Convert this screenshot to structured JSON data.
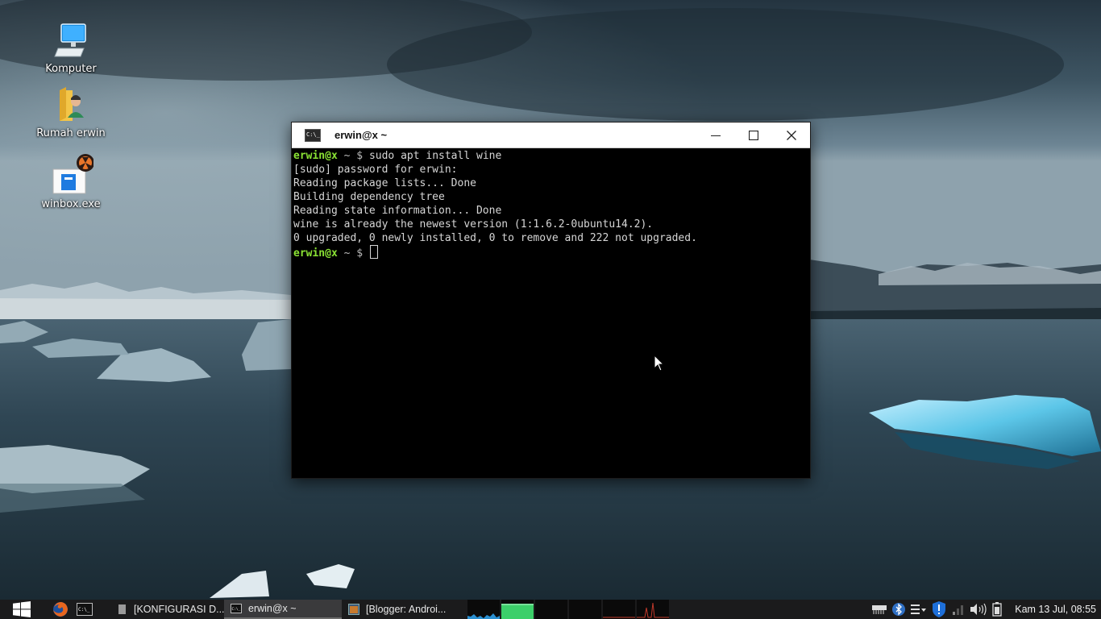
{
  "desktop": {
    "icons": [
      {
        "label": "Komputer",
        "icon": "computer-icon"
      },
      {
        "label": "Rumah erwin",
        "icon": "home-folder-icon"
      },
      {
        "label": "winbox.exe",
        "icon": "wine-exe-icon"
      }
    ]
  },
  "terminal": {
    "title": "erwin@x ~",
    "prompt_user": "erwin@x",
    "prompt_path": "~ $",
    "command": "sudo apt install wine",
    "output": [
      "[sudo] password for erwin:",
      "Reading package lists... Done",
      "Building dependency tree",
      "Reading state information... Done",
      "wine is already the newest version (1:1.6.2-0ubuntu14.2).",
      "0 upgraded, 0 newly installed, 0 to remove and 222 not upgraded."
    ],
    "buttons": {
      "minimize": "minimize-icon",
      "maximize": "maximize-icon",
      "close": "close-icon"
    }
  },
  "taskbar": {
    "tasks": [
      {
        "label": "[KONFIGURASI D...",
        "icon": "document-icon",
        "active": false
      },
      {
        "label": "erwin@x ~",
        "icon": "terminal-icon",
        "active": true
      },
      {
        "label": "[Blogger: Androi...",
        "icon": "browser-window-icon",
        "active": false
      }
    ],
    "clock": "Kam 13 Jul, 08:55"
  },
  "colors": {
    "prompt_green": "#8ae234",
    "taskbar_bg": "#1b1b1c",
    "cpu_graph": "#2a8fd0",
    "mem_graph": "#3ccf6a",
    "load_graph": "#c0392b"
  }
}
